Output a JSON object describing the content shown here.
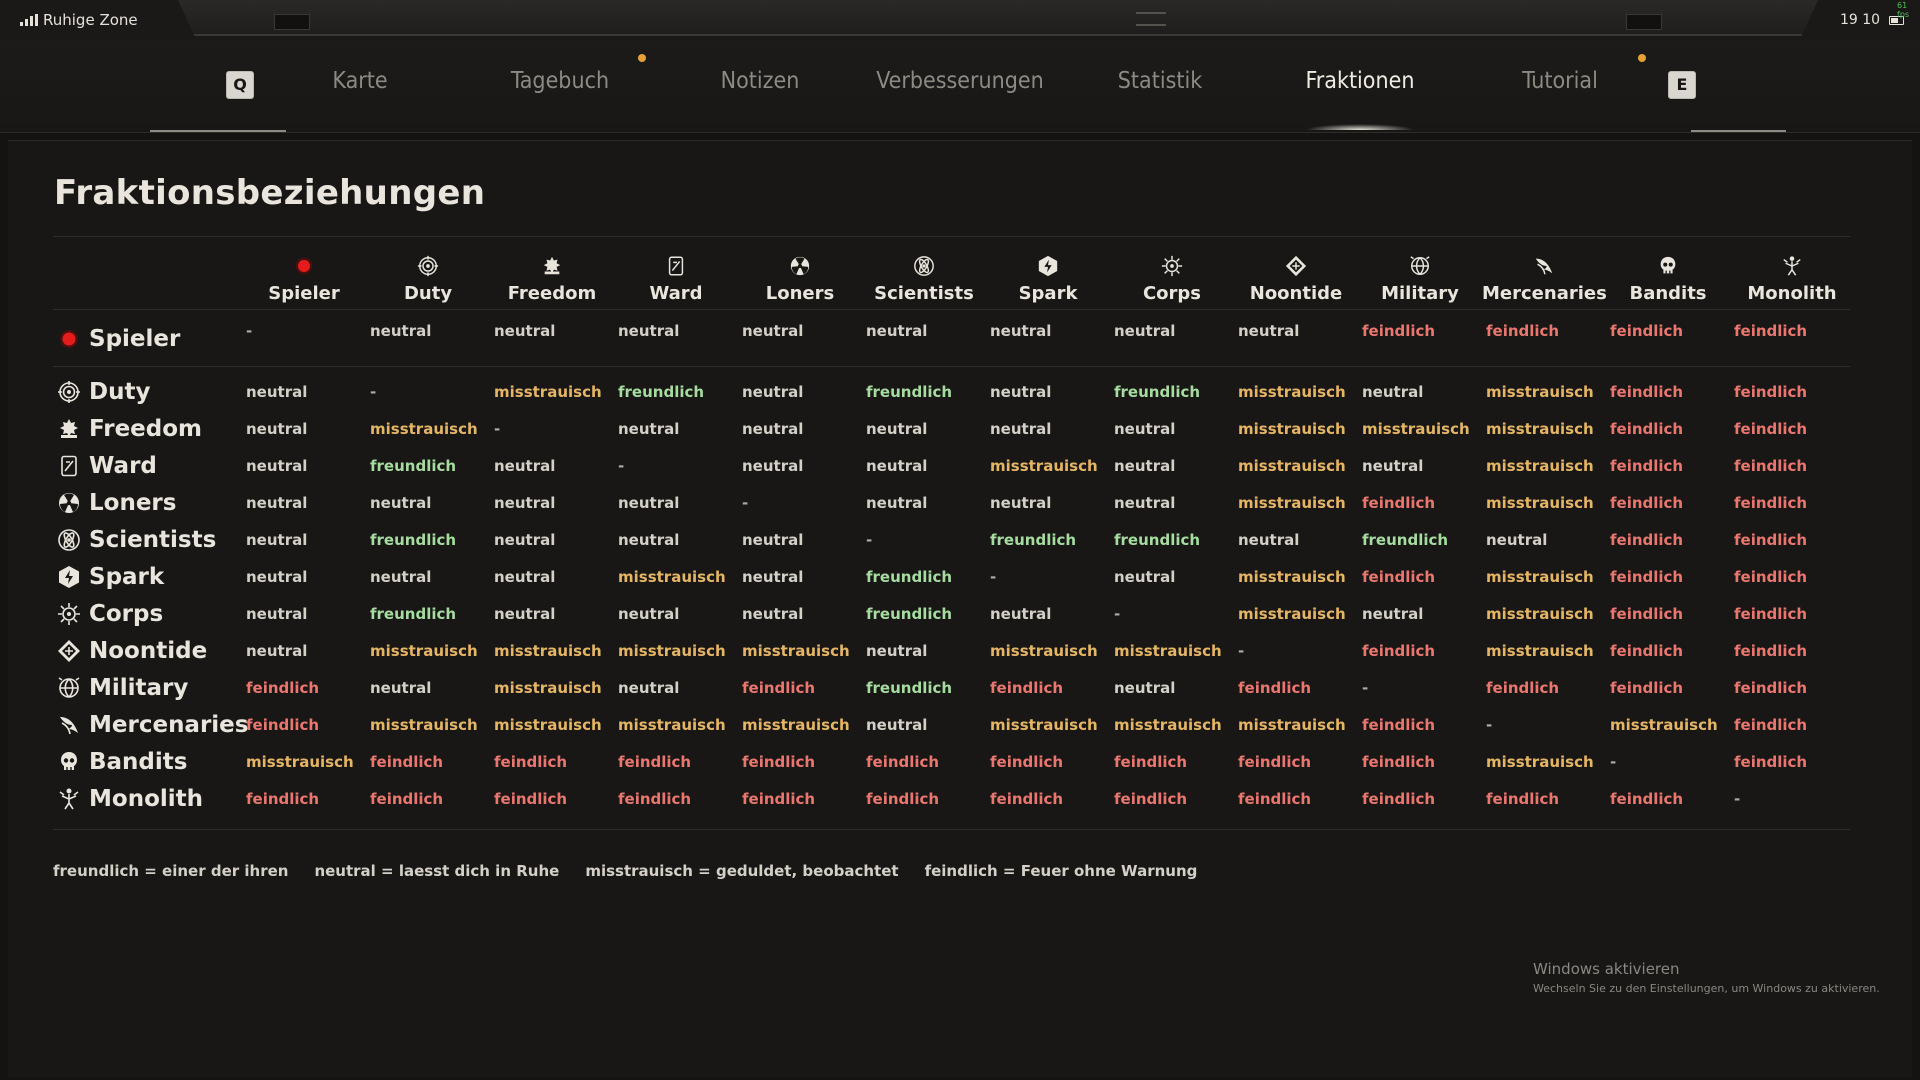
{
  "status": {
    "zone": "Ruhige Zone",
    "time": "19 10",
    "fps": "61 fps"
  },
  "tabs": {
    "left_key": "Q",
    "right_key": "E",
    "items": [
      {
        "label": "Karte",
        "notify": false,
        "active": false
      },
      {
        "label": "Tagebuch",
        "notify": true,
        "active": false
      },
      {
        "label": "Notizen",
        "notify": false,
        "active": false
      },
      {
        "label": "Verbesserungen",
        "notify": false,
        "active": false
      },
      {
        "label": "Statistik",
        "notify": false,
        "active": false
      },
      {
        "label": "Fraktionen",
        "notify": false,
        "active": true
      },
      {
        "label": "Tutorial",
        "notify": true,
        "active": false
      }
    ]
  },
  "page": {
    "title": "Fraktionsbeziehungen"
  },
  "factions": [
    {
      "name": "Spieler",
      "icon": "player-dot-icon"
    },
    {
      "name": "Duty",
      "icon": "duty-crest-icon"
    },
    {
      "name": "Freedom",
      "icon": "freedom-leaf-icon"
    },
    {
      "name": "Ward",
      "icon": "ward-shield-icon"
    },
    {
      "name": "Loners",
      "icon": "loners-radiation-icon"
    },
    {
      "name": "Scientists",
      "icon": "scientists-atom-icon"
    },
    {
      "name": "Spark",
      "icon": "spark-hexagon-icon"
    },
    {
      "name": "Corps",
      "icon": "corps-gear-icon"
    },
    {
      "name": "Noontide",
      "icon": "noontide-diamond-icon"
    },
    {
      "name": "Military",
      "icon": "military-globe-icon"
    },
    {
      "name": "Mercenaries",
      "icon": "mercenaries-wing-icon"
    },
    {
      "name": "Bandits",
      "icon": "bandits-skull-icon"
    },
    {
      "name": "Monolith",
      "icon": "monolith-figure-icon"
    }
  ],
  "matrix": [
    [
      "-",
      "neutral",
      "neutral",
      "neutral",
      "neutral",
      "neutral",
      "neutral",
      "neutral",
      "neutral",
      "feindlich",
      "feindlich",
      "feindlich",
      "feindlich"
    ],
    [
      "neutral",
      "-",
      "misstrauisch",
      "freundlich",
      "neutral",
      "freundlich",
      "neutral",
      "freundlich",
      "misstrauisch",
      "neutral",
      "misstrauisch",
      "feindlich",
      "feindlich"
    ],
    [
      "neutral",
      "misstrauisch",
      "-",
      "neutral",
      "neutral",
      "neutral",
      "neutral",
      "neutral",
      "misstrauisch",
      "misstrauisch",
      "misstrauisch",
      "feindlich",
      "feindlich"
    ],
    [
      "neutral",
      "freundlich",
      "neutral",
      "-",
      "neutral",
      "neutral",
      "misstrauisch",
      "neutral",
      "misstrauisch",
      "neutral",
      "misstrauisch",
      "feindlich",
      "feindlich"
    ],
    [
      "neutral",
      "neutral",
      "neutral",
      "neutral",
      "-",
      "neutral",
      "neutral",
      "neutral",
      "misstrauisch",
      "feindlich",
      "misstrauisch",
      "feindlich",
      "feindlich"
    ],
    [
      "neutral",
      "freundlich",
      "neutral",
      "neutral",
      "neutral",
      "-",
      "freundlich",
      "freundlich",
      "neutral",
      "freundlich",
      "neutral",
      "feindlich",
      "feindlich"
    ],
    [
      "neutral",
      "neutral",
      "neutral",
      "misstrauisch",
      "neutral",
      "freundlich",
      "-",
      "neutral",
      "misstrauisch",
      "feindlich",
      "misstrauisch",
      "feindlich",
      "feindlich"
    ],
    [
      "neutral",
      "freundlich",
      "neutral",
      "neutral",
      "neutral",
      "freundlich",
      "neutral",
      "-",
      "misstrauisch",
      "neutral",
      "misstrauisch",
      "feindlich",
      "feindlich"
    ],
    [
      "neutral",
      "misstrauisch",
      "misstrauisch",
      "misstrauisch",
      "misstrauisch",
      "neutral",
      "misstrauisch",
      "misstrauisch",
      "-",
      "feindlich",
      "misstrauisch",
      "feindlich",
      "feindlich"
    ],
    [
      "feindlich",
      "neutral",
      "misstrauisch",
      "neutral",
      "feindlich",
      "freundlich",
      "feindlich",
      "neutral",
      "feindlich",
      "-",
      "feindlich",
      "feindlich",
      "feindlich"
    ],
    [
      "feindlich",
      "misstrauisch",
      "misstrauisch",
      "misstrauisch",
      "misstrauisch",
      "neutral",
      "misstrauisch",
      "misstrauisch",
      "misstrauisch",
      "feindlich",
      "-",
      "misstrauisch",
      "feindlich"
    ],
    [
      "misstrauisch",
      "feindlich",
      "feindlich",
      "feindlich",
      "feindlich",
      "feindlich",
      "feindlich",
      "feindlich",
      "feindlich",
      "feindlich",
      "misstrauisch",
      "-",
      "feindlich"
    ],
    [
      "feindlich",
      "feindlich",
      "feindlich",
      "feindlich",
      "feindlich",
      "feindlich",
      "feindlich",
      "feindlich",
      "feindlich",
      "feindlich",
      "feindlich",
      "feindlich",
      "-"
    ]
  ],
  "colors": {
    "freundlich": "#a6dca0",
    "neutral": "#d4d0c8",
    "misstrauisch": "#e5b566",
    "feindlich": "#ea7670",
    "player": "#e51c1c",
    "notify": "#e6a235"
  },
  "legend": [
    "freundlich = einer der ihren",
    "neutral = laesst dich in Ruhe",
    "misstrauisch = geduldet, beobachtet",
    "feindlich = Feuer ohne Warnung"
  ],
  "watermark": {
    "title": "Windows aktivieren",
    "subtitle": "Wechseln Sie zu den Einstellungen, um Windows zu aktivieren."
  }
}
